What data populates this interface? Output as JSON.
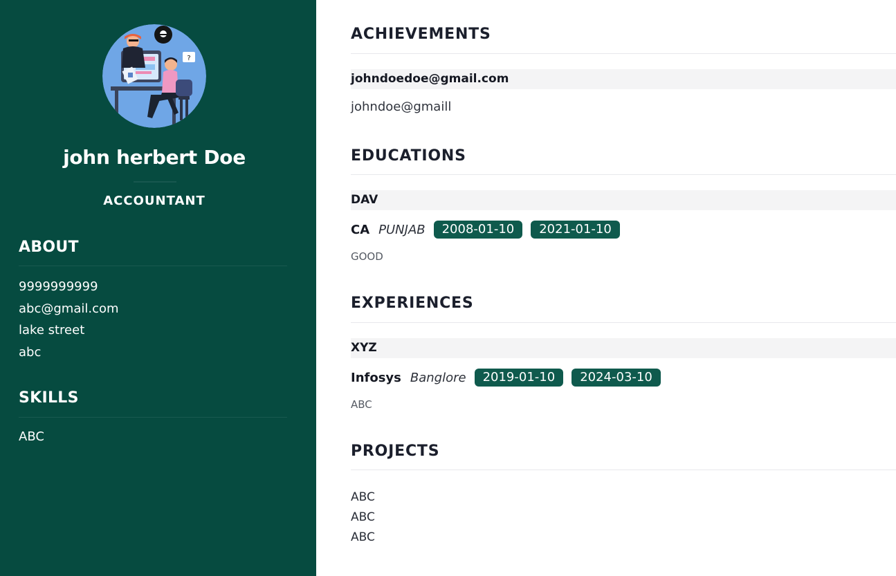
{
  "sidebar": {
    "name": "john herbert Doe",
    "role": "ACCOUNTANT",
    "about_heading": "ABOUT",
    "about_items": [
      "9999999999",
      "abc@gmail.com",
      "lake street",
      "abc"
    ],
    "skills_heading": "SKILLS",
    "skills_items": [
      "ABC"
    ]
  },
  "main": {
    "achievements": {
      "heading": "ACHIEVEMENTS",
      "title": "johndoedoe@gmail.com",
      "detail": "johndoe@gmaill"
    },
    "educations": {
      "heading": "EDUCATIONS",
      "institution": "DAV",
      "degree": "CA",
      "location": "PUNJAB",
      "start": "2008-01-10",
      "end": "2021-01-10",
      "note": "GOOD"
    },
    "experiences": {
      "heading": "EXPERIENCES",
      "title": "XYZ",
      "company": "Infosys",
      "location": "Banglore",
      "start": "2019-01-10",
      "end": "2024-03-10",
      "note": "ABC"
    },
    "projects": {
      "heading": "PROJECTS",
      "items": [
        "ABC",
        "ABC",
        "ABC"
      ]
    }
  },
  "colors": {
    "sidebar_bg": "#064b40",
    "date_pill_bg": "#0f5a4d",
    "band_bg": "#f4f4f5"
  },
  "icons": {
    "avatar": "avatar-illustration"
  }
}
